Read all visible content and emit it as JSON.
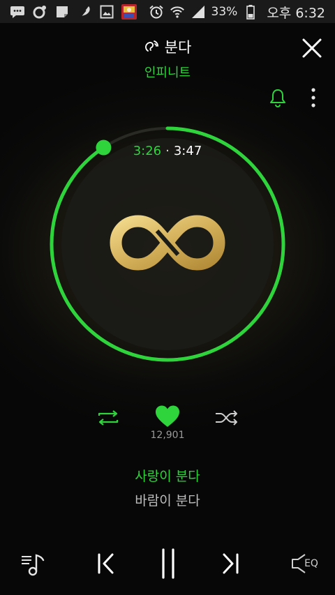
{
  "status_bar": {
    "battery_percent": "33%",
    "time": "오후 6:32"
  },
  "header": {
    "song_title": "분다",
    "artist": "인피니트"
  },
  "player": {
    "elapsed": "3:26",
    "separator": "·",
    "total": "3:47",
    "progress_fraction": 0.907
  },
  "actions": {
    "like_count": "12,901"
  },
  "lyrics": {
    "current": "사랑이 분다",
    "next": "바람이 분다"
  },
  "controls": {
    "eq_label": "EQ"
  },
  "colors": {
    "accent": "#2fd43d",
    "logo_gold": "#d4b05a"
  },
  "icons": [
    "message-icon",
    "notification-icon",
    "memo-icon",
    "feather-icon",
    "gallery-icon",
    "app-thumbnail-icon",
    "alarm-icon",
    "wifi-icon",
    "signal-icon",
    "battery-icon",
    "voice-icon",
    "close-icon",
    "bell-icon",
    "more-vertical-icon",
    "repeat-icon",
    "heart-icon",
    "shuffle-icon",
    "playlist-icon",
    "previous-icon",
    "pause-icon",
    "next-icon",
    "eq-speaker-icon"
  ]
}
